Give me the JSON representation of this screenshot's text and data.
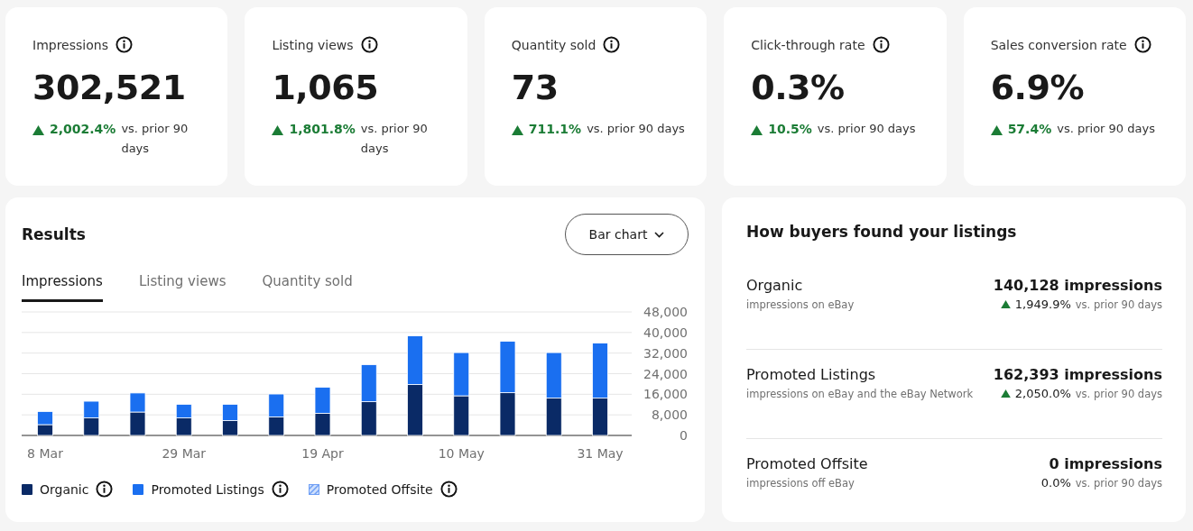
{
  "metrics": [
    {
      "title": "Impressions",
      "value": "302,521",
      "change": "2,002.4%",
      "rising": true,
      "comparison": "vs. prior 90 days"
    },
    {
      "title": "Listing views",
      "value": "1,065",
      "change": "1,801.8%",
      "rising": true,
      "comparison": "vs. prior 90 days"
    },
    {
      "title": "Quantity sold",
      "value": "73",
      "change": "711.1%",
      "rising": true,
      "comparison": "vs. prior 90 days"
    },
    {
      "title": "Click-through rate",
      "value": "0.3%",
      "change": "10.5%",
      "rising": true,
      "comparison": "vs. prior 90 days"
    },
    {
      "title": "Sales conversion rate",
      "value": "6.9%",
      "change": "57.4%",
      "rising": true,
      "comparison": "vs. prior 90 days"
    }
  ],
  "results": {
    "title": "Results",
    "chart_type_button": "Bar chart",
    "tabs": [
      {
        "label": "Impressions",
        "selected": true
      },
      {
        "label": "Listing views",
        "selected": false
      },
      {
        "label": "Quantity sold",
        "selected": false
      }
    ],
    "chart_data": {
      "type": "bar",
      "stacked": true,
      "grid": true,
      "categories": [
        "8 Mar",
        null,
        null,
        "29 Mar",
        null,
        null,
        "19 Apr",
        null,
        null,
        "10 May",
        null,
        null,
        "31 May"
      ],
      "series": [
        {
          "name": "Organic",
          "color": "#0a2a66",
          "values": [
            4200,
            6800,
            9100,
            6800,
            5800,
            7200,
            8600,
            13100,
            19800,
            15400,
            16600,
            14500,
            14500
          ]
        },
        {
          "name": "Promoted Listings",
          "color": "#1a6ff0",
          "values": [
            5100,
            6500,
            7400,
            5300,
            6300,
            8900,
            10100,
            14400,
            18900,
            16800,
            20000,
            17700,
            21400
          ]
        },
        {
          "name": "Promoted Offsite",
          "color": "#6f9ff5",
          "values": [
            0,
            0,
            0,
            0,
            0,
            0,
            0,
            0,
            0,
            0,
            0,
            0,
            0
          ]
        }
      ],
      "ylim": [
        0,
        48000
      ],
      "yticks": [
        {
          "value": 0,
          "label": "0"
        },
        {
          "value": 8000,
          "label": "8,000"
        },
        {
          "value": 16000,
          "label": "16,000"
        },
        {
          "value": 24000,
          "label": "24,000"
        },
        {
          "value": 32000,
          "label": "32,000"
        },
        {
          "value": 40000,
          "label": "40,000"
        },
        {
          "value": 48000,
          "label": "48,000"
        }
      ]
    },
    "legend": [
      {
        "kind": "solid"
      },
      {
        "kind": "solid"
      },
      {
        "kind": "hatched"
      }
    ]
  },
  "sources": {
    "title": "How buyers found your listings",
    "rows": [
      {
        "name": "Organic",
        "description": "impressions on eBay",
        "impressions": "140,128 impressions",
        "change": "1,949.9%",
        "rising": true,
        "comparison": "vs. prior 90 days"
      },
      {
        "name": "Promoted Listings",
        "description": "impressions on eBay and the eBay Network",
        "impressions": "162,393 impressions",
        "change": "2,050.0%",
        "rising": true,
        "comparison": "vs. prior 90 days"
      },
      {
        "name": "Promoted Offsite",
        "description": "impressions off eBay",
        "impressions": "0 impressions",
        "change": "0.0%",
        "rising": false,
        "comparison": "vs. prior 90 days"
      }
    ]
  }
}
